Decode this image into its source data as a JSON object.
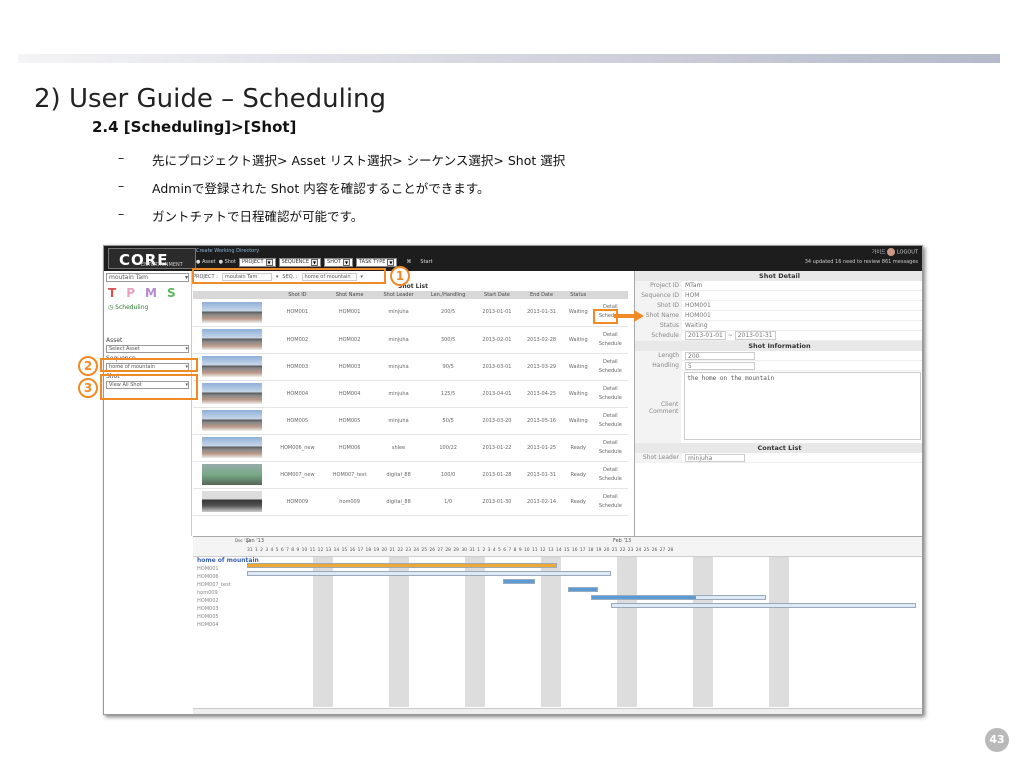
{
  "slide": {
    "title": "2) User Guide – Scheduling",
    "subtitle": "2.4 [Scheduling]>[Shot]",
    "bullets": [
      "先にプロジェクト選択> Asset リスト選択> シーケンス選択> Shot 選択",
      "Adminで登録された Shot 内容を確認することができます。",
      "ガントチァトで日程確認が可能です。"
    ],
    "page_number": "43",
    "callouts": [
      "1",
      "2",
      "3"
    ]
  },
  "app": {
    "logo": "CORE",
    "logo_sub": "ENTERTAINMENT",
    "cwd_label": "Create Working Directory",
    "toolbar": {
      "asset": "Asset",
      "shot": "Shot",
      "project": "PROJECT",
      "sequence": "SEQUENCE",
      "shot_dd": "SHOT",
      "task_type": "TASK TYPE",
      "start": "Start"
    },
    "status": "34 updated  16 need to review  861 messages",
    "logout": "LOGOUT",
    "user": "가이드"
  },
  "left": {
    "project_value": "moutain Tam",
    "tpms": [
      "T",
      "P",
      "M",
      "S"
    ],
    "scheduling": "Scheduling",
    "asset_label": "Asset",
    "asset_value": "Select Asset",
    "sequence_label": "Sequence",
    "sequence_value": "home of mountain",
    "shot_label": "Shot",
    "shot_value": "View All Shot"
  },
  "filter": {
    "project_label": "PROJECT :",
    "project_value": "moutain Tam",
    "seq_label": "SEQ. :",
    "seq_value": "home of mountain"
  },
  "shot_list": {
    "title": "Shot List",
    "columns": [
      "",
      "Shot ID",
      "Shot Name",
      "Shot Leader",
      "Len./Handling",
      "Start Date",
      "End Date",
      "Status",
      ""
    ],
    "rows": [
      {
        "thumb": "a",
        "id": "HOM001",
        "name": "HOM001",
        "leader": "minjuha",
        "len": "200/5",
        "start": "2013-01-01",
        "end": "2013-01-31",
        "status": "Waiting"
      },
      {
        "thumb": "a",
        "id": "HOM002",
        "name": "HOM002",
        "leader": "minjuha",
        "len": "300/5",
        "start": "2013-02-01",
        "end": "2013-02-28",
        "status": "Waiting"
      },
      {
        "thumb": "a",
        "id": "HOM003",
        "name": "HOM003",
        "leader": "minjuha",
        "len": "90/5",
        "start": "2013-03-01",
        "end": "2013-03-29",
        "status": "Waiting"
      },
      {
        "thumb": "a",
        "id": "HOM004",
        "name": "HOM004",
        "leader": "minjuha",
        "len": "125/5",
        "start": "2013-04-01",
        "end": "2013-04-25",
        "status": "Waiting"
      },
      {
        "thumb": "a",
        "id": "HOM005",
        "name": "HOM005",
        "leader": "minjuha",
        "len": "50/5",
        "start": "2013-03-20",
        "end": "2013-05-16",
        "status": "Waiting"
      },
      {
        "thumb": "a",
        "id": "HOM006_new",
        "name": "HOM006",
        "leader": "shlee",
        "len": "100/22",
        "start": "2013-01-22",
        "end": "2013-01-25",
        "status": "Ready"
      },
      {
        "thumb": "g",
        "id": "HOM007_new",
        "name": "HOM007_test",
        "leader": "digital_88",
        "len": "100/0",
        "start": "2013-01-28",
        "end": "2013-01-31",
        "status": "Ready"
      },
      {
        "thumb": "b",
        "id": "HOM009",
        "name": "hom009",
        "leader": "digital_88",
        "len": "1/0",
        "start": "2013-01-30",
        "end": "2013-02-14",
        "status": "Ready"
      }
    ],
    "detail_label": "Detail",
    "schedule_label": "Schedule"
  },
  "detail": {
    "header": "Shot Detail",
    "fields": [
      {
        "k": "Project ID",
        "v": "MTam"
      },
      {
        "k": "Sequence ID",
        "v": "HOM"
      },
      {
        "k": "Shot ID",
        "v": "HOM001"
      },
      {
        "k": "Shot Name",
        "v": "HOM001"
      },
      {
        "k": "Status",
        "v": "Waiting"
      }
    ],
    "schedule_label": "Schedule",
    "schedule_start": "2013-01-01",
    "schedule_end": "2013-01-31",
    "info_header": "Shot Information",
    "length_label": "Length",
    "length_value": "200",
    "handling_label": "Handling",
    "handling_value": "5",
    "comment_label": "Client Comment",
    "comment_value": "the home on the mountain",
    "contact_header": "Contact List",
    "leader_label": "Shot Leader",
    "leader_value": "minjuha"
  },
  "gantt": {
    "month_a": "Jan '13",
    "month_b": "Feb '13",
    "dec_label": "Dec '12",
    "days": "31  1  2  3  4  5  6  7  8  9  10  11  12  13  14  15  16  17  18  19  20  21  22  23  24  25  26  27  28  29  30  31  1  2  3  4  5  6  7  8  9  10  11  12  13  14  15  16  17  18  19  20  21  22  23  24  25  26  27  28",
    "group": "home of mountain",
    "rows": [
      "HOM001",
      "HOM006",
      "HOM007_test",
      "hom009",
      "HOM002",
      "HOM003",
      "HOM005",
      "HOM004"
    ],
    "colors": {
      "bar": "#dfe9f5",
      "progress": "#5a9bd6",
      "group": "#f0a830",
      "weekend": "#dddddd"
    }
  }
}
